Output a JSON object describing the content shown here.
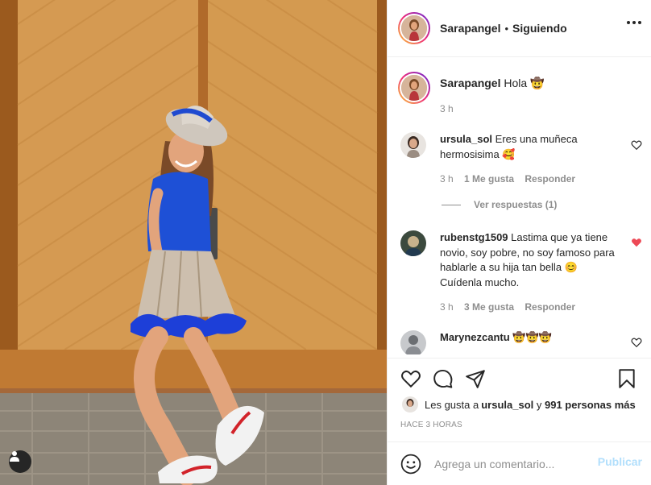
{
  "post": {
    "username": "Sarapangel",
    "dot": "•",
    "follow_status": "Siguiendo",
    "more_icon": "more-options-icon"
  },
  "caption": {
    "username": "Sarapangel",
    "text": "Hola 🤠",
    "time": "3 h"
  },
  "comments": [
    {
      "username": "ursula_sol",
      "text": "Eres una muñeca hermosisima 🥰",
      "time": "3 h",
      "likes": "1 Me gusta",
      "reply": "Responder",
      "liked": false
    },
    {
      "username": "rubenstg1509",
      "text": "Lastima que ya tiene novio, soy pobre, no soy famoso para hablarle a su hija tan bella 😊 Cuídenla mucho.",
      "time": "3 h",
      "likes": "3 Me gusta",
      "reply": "Responder",
      "liked": true
    },
    {
      "username": "Marynezcantu",
      "text": "🤠🤠🤠",
      "liked": false
    }
  ],
  "view_replies": "Ver respuestas (1)",
  "likes": {
    "prefix": "Les gusta a ",
    "user": "ursula_sol",
    "middle": " y ",
    "count": "991 personas más"
  },
  "timestamp": "HACE 3 HORAS",
  "comment_input": {
    "placeholder": "Agrega un comentario..."
  },
  "publish_label": "Publicar",
  "colors": {
    "accent_disabled": "#b2dffc",
    "liked_heart": "#ed4956",
    "muted_text": "#8e8e8e",
    "border": "#efefef"
  }
}
